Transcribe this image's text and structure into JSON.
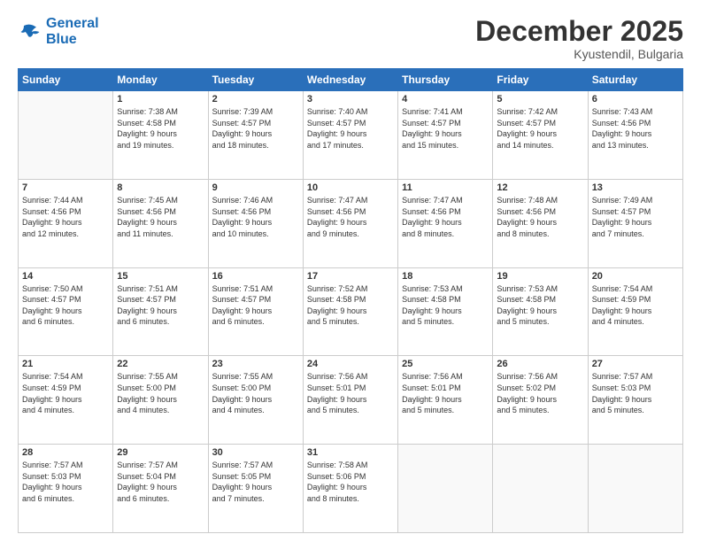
{
  "logo": {
    "line1": "General",
    "line2": "Blue"
  },
  "header": {
    "month": "December 2025",
    "location": "Kyustendil, Bulgaria"
  },
  "weekdays": [
    "Sunday",
    "Monday",
    "Tuesday",
    "Wednesday",
    "Thursday",
    "Friday",
    "Saturday"
  ],
  "weeks": [
    [
      {
        "day": "",
        "content": ""
      },
      {
        "day": "1",
        "content": "Sunrise: 7:38 AM\nSunset: 4:58 PM\nDaylight: 9 hours\nand 19 minutes."
      },
      {
        "day": "2",
        "content": "Sunrise: 7:39 AM\nSunset: 4:57 PM\nDaylight: 9 hours\nand 18 minutes."
      },
      {
        "day": "3",
        "content": "Sunrise: 7:40 AM\nSunset: 4:57 PM\nDaylight: 9 hours\nand 17 minutes."
      },
      {
        "day": "4",
        "content": "Sunrise: 7:41 AM\nSunset: 4:57 PM\nDaylight: 9 hours\nand 15 minutes."
      },
      {
        "day": "5",
        "content": "Sunrise: 7:42 AM\nSunset: 4:57 PM\nDaylight: 9 hours\nand 14 minutes."
      },
      {
        "day": "6",
        "content": "Sunrise: 7:43 AM\nSunset: 4:56 PM\nDaylight: 9 hours\nand 13 minutes."
      }
    ],
    [
      {
        "day": "7",
        "content": "Sunrise: 7:44 AM\nSunset: 4:56 PM\nDaylight: 9 hours\nand 12 minutes."
      },
      {
        "day": "8",
        "content": "Sunrise: 7:45 AM\nSunset: 4:56 PM\nDaylight: 9 hours\nand 11 minutes."
      },
      {
        "day": "9",
        "content": "Sunrise: 7:46 AM\nSunset: 4:56 PM\nDaylight: 9 hours\nand 10 minutes."
      },
      {
        "day": "10",
        "content": "Sunrise: 7:47 AM\nSunset: 4:56 PM\nDaylight: 9 hours\nand 9 minutes."
      },
      {
        "day": "11",
        "content": "Sunrise: 7:47 AM\nSunset: 4:56 PM\nDaylight: 9 hours\nand 8 minutes."
      },
      {
        "day": "12",
        "content": "Sunrise: 7:48 AM\nSunset: 4:56 PM\nDaylight: 9 hours\nand 8 minutes."
      },
      {
        "day": "13",
        "content": "Sunrise: 7:49 AM\nSunset: 4:57 PM\nDaylight: 9 hours\nand 7 minutes."
      }
    ],
    [
      {
        "day": "14",
        "content": "Sunrise: 7:50 AM\nSunset: 4:57 PM\nDaylight: 9 hours\nand 6 minutes."
      },
      {
        "day": "15",
        "content": "Sunrise: 7:51 AM\nSunset: 4:57 PM\nDaylight: 9 hours\nand 6 minutes."
      },
      {
        "day": "16",
        "content": "Sunrise: 7:51 AM\nSunset: 4:57 PM\nDaylight: 9 hours\nand 6 minutes."
      },
      {
        "day": "17",
        "content": "Sunrise: 7:52 AM\nSunset: 4:58 PM\nDaylight: 9 hours\nand 5 minutes."
      },
      {
        "day": "18",
        "content": "Sunrise: 7:53 AM\nSunset: 4:58 PM\nDaylight: 9 hours\nand 5 minutes."
      },
      {
        "day": "19",
        "content": "Sunrise: 7:53 AM\nSunset: 4:58 PM\nDaylight: 9 hours\nand 5 minutes."
      },
      {
        "day": "20",
        "content": "Sunrise: 7:54 AM\nSunset: 4:59 PM\nDaylight: 9 hours\nand 4 minutes."
      }
    ],
    [
      {
        "day": "21",
        "content": "Sunrise: 7:54 AM\nSunset: 4:59 PM\nDaylight: 9 hours\nand 4 minutes."
      },
      {
        "day": "22",
        "content": "Sunrise: 7:55 AM\nSunset: 5:00 PM\nDaylight: 9 hours\nand 4 minutes."
      },
      {
        "day": "23",
        "content": "Sunrise: 7:55 AM\nSunset: 5:00 PM\nDaylight: 9 hours\nand 4 minutes."
      },
      {
        "day": "24",
        "content": "Sunrise: 7:56 AM\nSunset: 5:01 PM\nDaylight: 9 hours\nand 5 minutes."
      },
      {
        "day": "25",
        "content": "Sunrise: 7:56 AM\nSunset: 5:01 PM\nDaylight: 9 hours\nand 5 minutes."
      },
      {
        "day": "26",
        "content": "Sunrise: 7:56 AM\nSunset: 5:02 PM\nDaylight: 9 hours\nand 5 minutes."
      },
      {
        "day": "27",
        "content": "Sunrise: 7:57 AM\nSunset: 5:03 PM\nDaylight: 9 hours\nand 5 minutes."
      }
    ],
    [
      {
        "day": "28",
        "content": "Sunrise: 7:57 AM\nSunset: 5:03 PM\nDaylight: 9 hours\nand 6 minutes."
      },
      {
        "day": "29",
        "content": "Sunrise: 7:57 AM\nSunset: 5:04 PM\nDaylight: 9 hours\nand 6 minutes."
      },
      {
        "day": "30",
        "content": "Sunrise: 7:57 AM\nSunset: 5:05 PM\nDaylight: 9 hours\nand 7 minutes."
      },
      {
        "day": "31",
        "content": "Sunrise: 7:58 AM\nSunset: 5:06 PM\nDaylight: 9 hours\nand 8 minutes."
      },
      {
        "day": "",
        "content": ""
      },
      {
        "day": "",
        "content": ""
      },
      {
        "day": "",
        "content": ""
      }
    ]
  ]
}
